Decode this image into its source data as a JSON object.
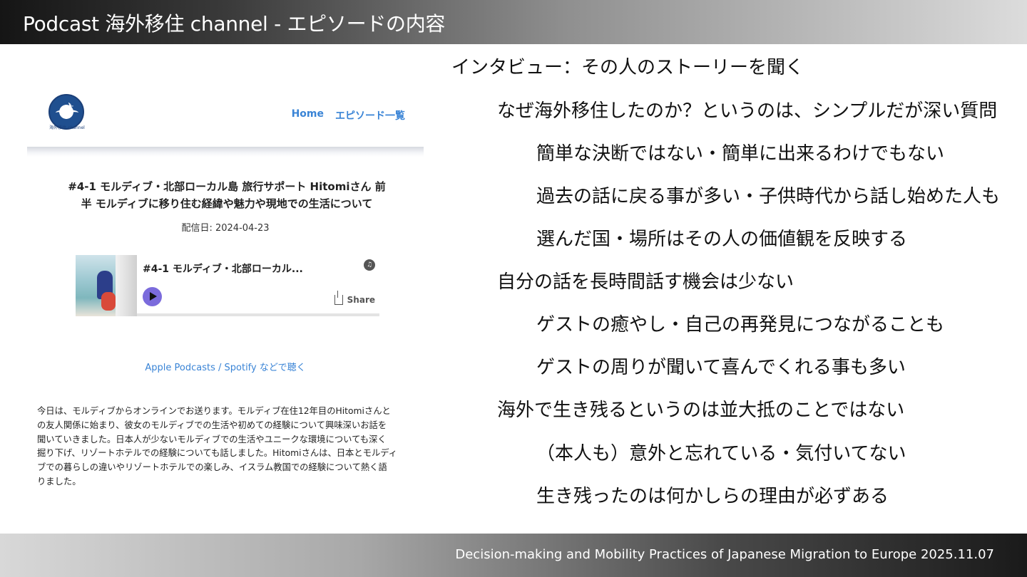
{
  "slide": {
    "title": "Podcast 海外移住 channel  - エピソードの内容",
    "footer": "Decision-making and Mobility Practices of Japanese Migration to Europe 2025.11.07"
  },
  "site": {
    "logo_caption": "海外移住 channel",
    "nav": {
      "home": "Home",
      "episodes": "エピソード一覧"
    },
    "episode_title_line1": "#4-1 モルディブ・北部ローカル島 旅行サポート Hitomiさん 前",
    "episode_title_line2": "半 モルディブに移り住む経緯や魅力や現地での生活について",
    "date": "配信日: 2024-04-23",
    "player": {
      "title": "#4-1 モルディブ・北部ローカル...",
      "share": "Share",
      "progress": 0
    },
    "listen_link": "Apple Podcasts / Spotify などで聴く",
    "description": [
      "今日は、モルディブからオンラインでお送ります。モルディブ在住12年目のHitomiさんと",
      "の友人関係に始まり、彼女のモルディブでの生活や初めての経験について興味深いお話を",
      "聞いていきました。日本人が少ないモルディブでの生活やユニークな環境についても深く",
      "掘り下げ、リゾートホテルでの経験についても話しました。Hitomiさんは、日本とモルディ",
      "ブでの暮らしの違いやリゾートホテルでの楽しみ、イスラム教国での経験について熱く語",
      "りました。"
    ]
  },
  "bullets": [
    "インタビュー：その人のストーリーを聞く",
    "なぜ海外移住したのか？というのは、シンプルだが深い質問",
    "簡単な決断ではない・簡単に出来るわけでもない",
    "過去の話に戻る事が多い・子供時代から話し始めた人も",
    "選んだ国・場所はその人の価値観を反映する",
    "自分の話を長時間話す機会は少ない",
    "ゲストの癒やし・自己の再発見につながることも",
    "ゲストの周りが聞いて喜んでくれる事も多い",
    "海外で生き残るというのは並大抵のことではない",
    "（本人も）意外と忘れている・気付いてない",
    "生き残ったのは何かしらの理由が必ずある"
  ]
}
